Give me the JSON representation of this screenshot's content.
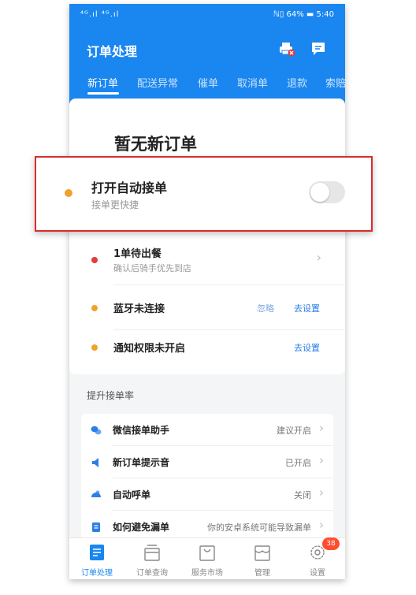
{
  "status_bar": {
    "left": "⁴ᴳ.ıl ⁴ᴳ.ıl",
    "right": "ℕ▯ 64% ▬ 5:40"
  },
  "header": {
    "title": "订单处理",
    "icons": [
      "printer-error-icon",
      "message-icon"
    ],
    "tabs": [
      {
        "label": "新订单",
        "active": true
      },
      {
        "label": "配送异常"
      },
      {
        "label": "催单"
      },
      {
        "label": "取消单"
      },
      {
        "label": "退款"
      },
      {
        "label": "索赔"
      }
    ]
  },
  "main": {
    "empty_title": "暂无新订单",
    "auto_accept": {
      "title": "打开自动接单",
      "subtitle": "接单更快捷",
      "toggle_on": false
    },
    "pending": {
      "title": "1单待出餐",
      "subtitle": "确认后骑手优先到店"
    },
    "bluetooth": {
      "title": "蓝牙未连接",
      "ignore_label": "忽略",
      "setup_label": "去设置"
    },
    "notification": {
      "title": "通知权限未开启",
      "setup_label": "去设置"
    },
    "colors": {
      "orange": "#f0a22c",
      "red": "#e23c3c",
      "brand": "#1a86f0",
      "highlight": "#d72c2c"
    }
  },
  "improve": {
    "section_title": "提升接单率",
    "items": [
      {
        "icon": "wechat-icon",
        "label": "微信接单助手",
        "value": "建议开启"
      },
      {
        "icon": "speaker-icon",
        "label": "新订单提示音",
        "value": "已开启"
      },
      {
        "icon": "phone-call-icon",
        "label": "自动呼单",
        "value": "关闭"
      },
      {
        "icon": "document-icon",
        "label": "如何避免漏单",
        "value": "你的安卓系统可能导致漏单"
      }
    ]
  },
  "bottom_nav": {
    "items": [
      {
        "label": "订单处理",
        "icon": "order-list-icon",
        "active": true
      },
      {
        "label": "订单查询",
        "icon": "inbox-icon"
      },
      {
        "label": "服务市场",
        "icon": "shopping-bag-icon"
      },
      {
        "label": "管理",
        "icon": "store-icon"
      },
      {
        "label": "设置",
        "icon": "gear-icon",
        "badge": "38"
      }
    ]
  }
}
